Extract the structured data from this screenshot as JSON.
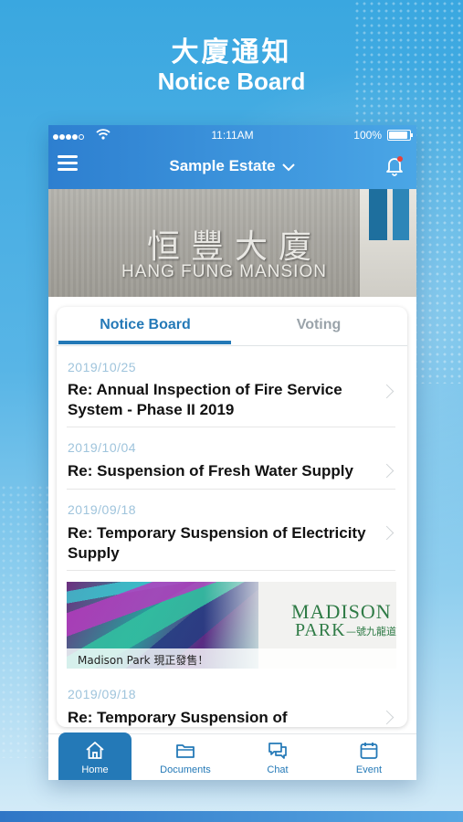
{
  "promo": {
    "title_cn": "大廈通知",
    "title_en": "Notice Board"
  },
  "status_bar": {
    "time": "11:11AM",
    "battery": "100%"
  },
  "header": {
    "estate_name": "Sample Estate"
  },
  "banner": {
    "building_cn": "恒豐大廈",
    "building_en": "HANG FUNG MANSION"
  },
  "tabs": {
    "notice_board": "Notice Board",
    "voting": "Voting"
  },
  "notices": [
    {
      "date": "2019/10/25",
      "title": "Re: Annual Inspection of Fire Service System - Phase II 2019"
    },
    {
      "date": "2019/10/04",
      "title": "Re: Suspension of Fresh Water Supply"
    },
    {
      "date": "2019/09/18",
      "title": "Re: Temporary Suspension of Electricity Supply"
    },
    {
      "date": "2019/09/18",
      "title": "Re: Temporary Suspension of"
    }
  ],
  "ad": {
    "brand_line1": "MADISON",
    "brand_line2": "PARK",
    "brand_sub": "—號九龍道",
    "caption": "Madison Park 現正發售！"
  },
  "tab_bar": {
    "home": "Home",
    "documents": "Documents",
    "chat": "Chat",
    "event": "Event"
  },
  "colors": {
    "accent": "#2479b7",
    "header_gradient_start": "#2d7fd0",
    "header_gradient_end": "#4aa6e6",
    "date_text": "#9fc4dc"
  },
  "icons": [
    "menu-icon",
    "chevron-down-icon",
    "bell-icon",
    "chevron-right-icon",
    "home-icon",
    "folder-icon",
    "chat-icon",
    "calendar-icon"
  ]
}
